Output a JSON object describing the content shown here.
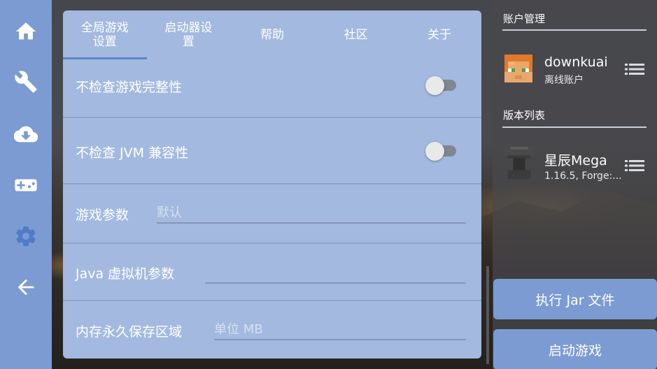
{
  "nav": {
    "items": [
      {
        "icon": "home-icon",
        "active": false
      },
      {
        "icon": "wrench-icon",
        "active": false
      },
      {
        "icon": "cloud-download-icon",
        "active": false
      },
      {
        "icon": "gamepad-icon",
        "active": false
      },
      {
        "icon": "gear-icon",
        "active": true
      },
      {
        "icon": "back-arrow-icon",
        "active": false
      }
    ]
  },
  "tabs": [
    {
      "label": "全局游戏设置",
      "active": true
    },
    {
      "label": "启动器设置",
      "active": false
    },
    {
      "label": "帮助",
      "active": false
    },
    {
      "label": "社区",
      "active": false
    },
    {
      "label": "关于",
      "active": false
    }
  ],
  "settings": {
    "skip_game_integrity": {
      "label": "不检查游戏完整性",
      "enabled": false
    },
    "skip_jvm_compat": {
      "label": "不检查 JVM 兼容性",
      "enabled": false
    },
    "game_args": {
      "label": "游戏参数",
      "value": "",
      "placeholder": "默认"
    },
    "jvm_args": {
      "label": "Java 虚拟机参数",
      "value": "",
      "placeholder": ""
    },
    "permgen": {
      "label": "内存永久保存区域",
      "value": "",
      "placeholder": "单位 MB"
    }
  },
  "sidebar": {
    "account_section": "账户管理",
    "account": {
      "name": "downkuai",
      "type": "离线账户",
      "avatar": "steve-head"
    },
    "version_section": "版本列表",
    "version": {
      "name": "星辰Mega",
      "detail": "1.16.5, Forge:...",
      "icon": "anvil"
    },
    "run_jar_label": "执行 Jar 文件",
    "launch_label": "启动游戏"
  },
  "colors": {
    "accent": "#7b9bd2",
    "panel": "#a3b9df",
    "tab_indicator": "#5b86c9",
    "active_nav": "#5b86c9"
  }
}
